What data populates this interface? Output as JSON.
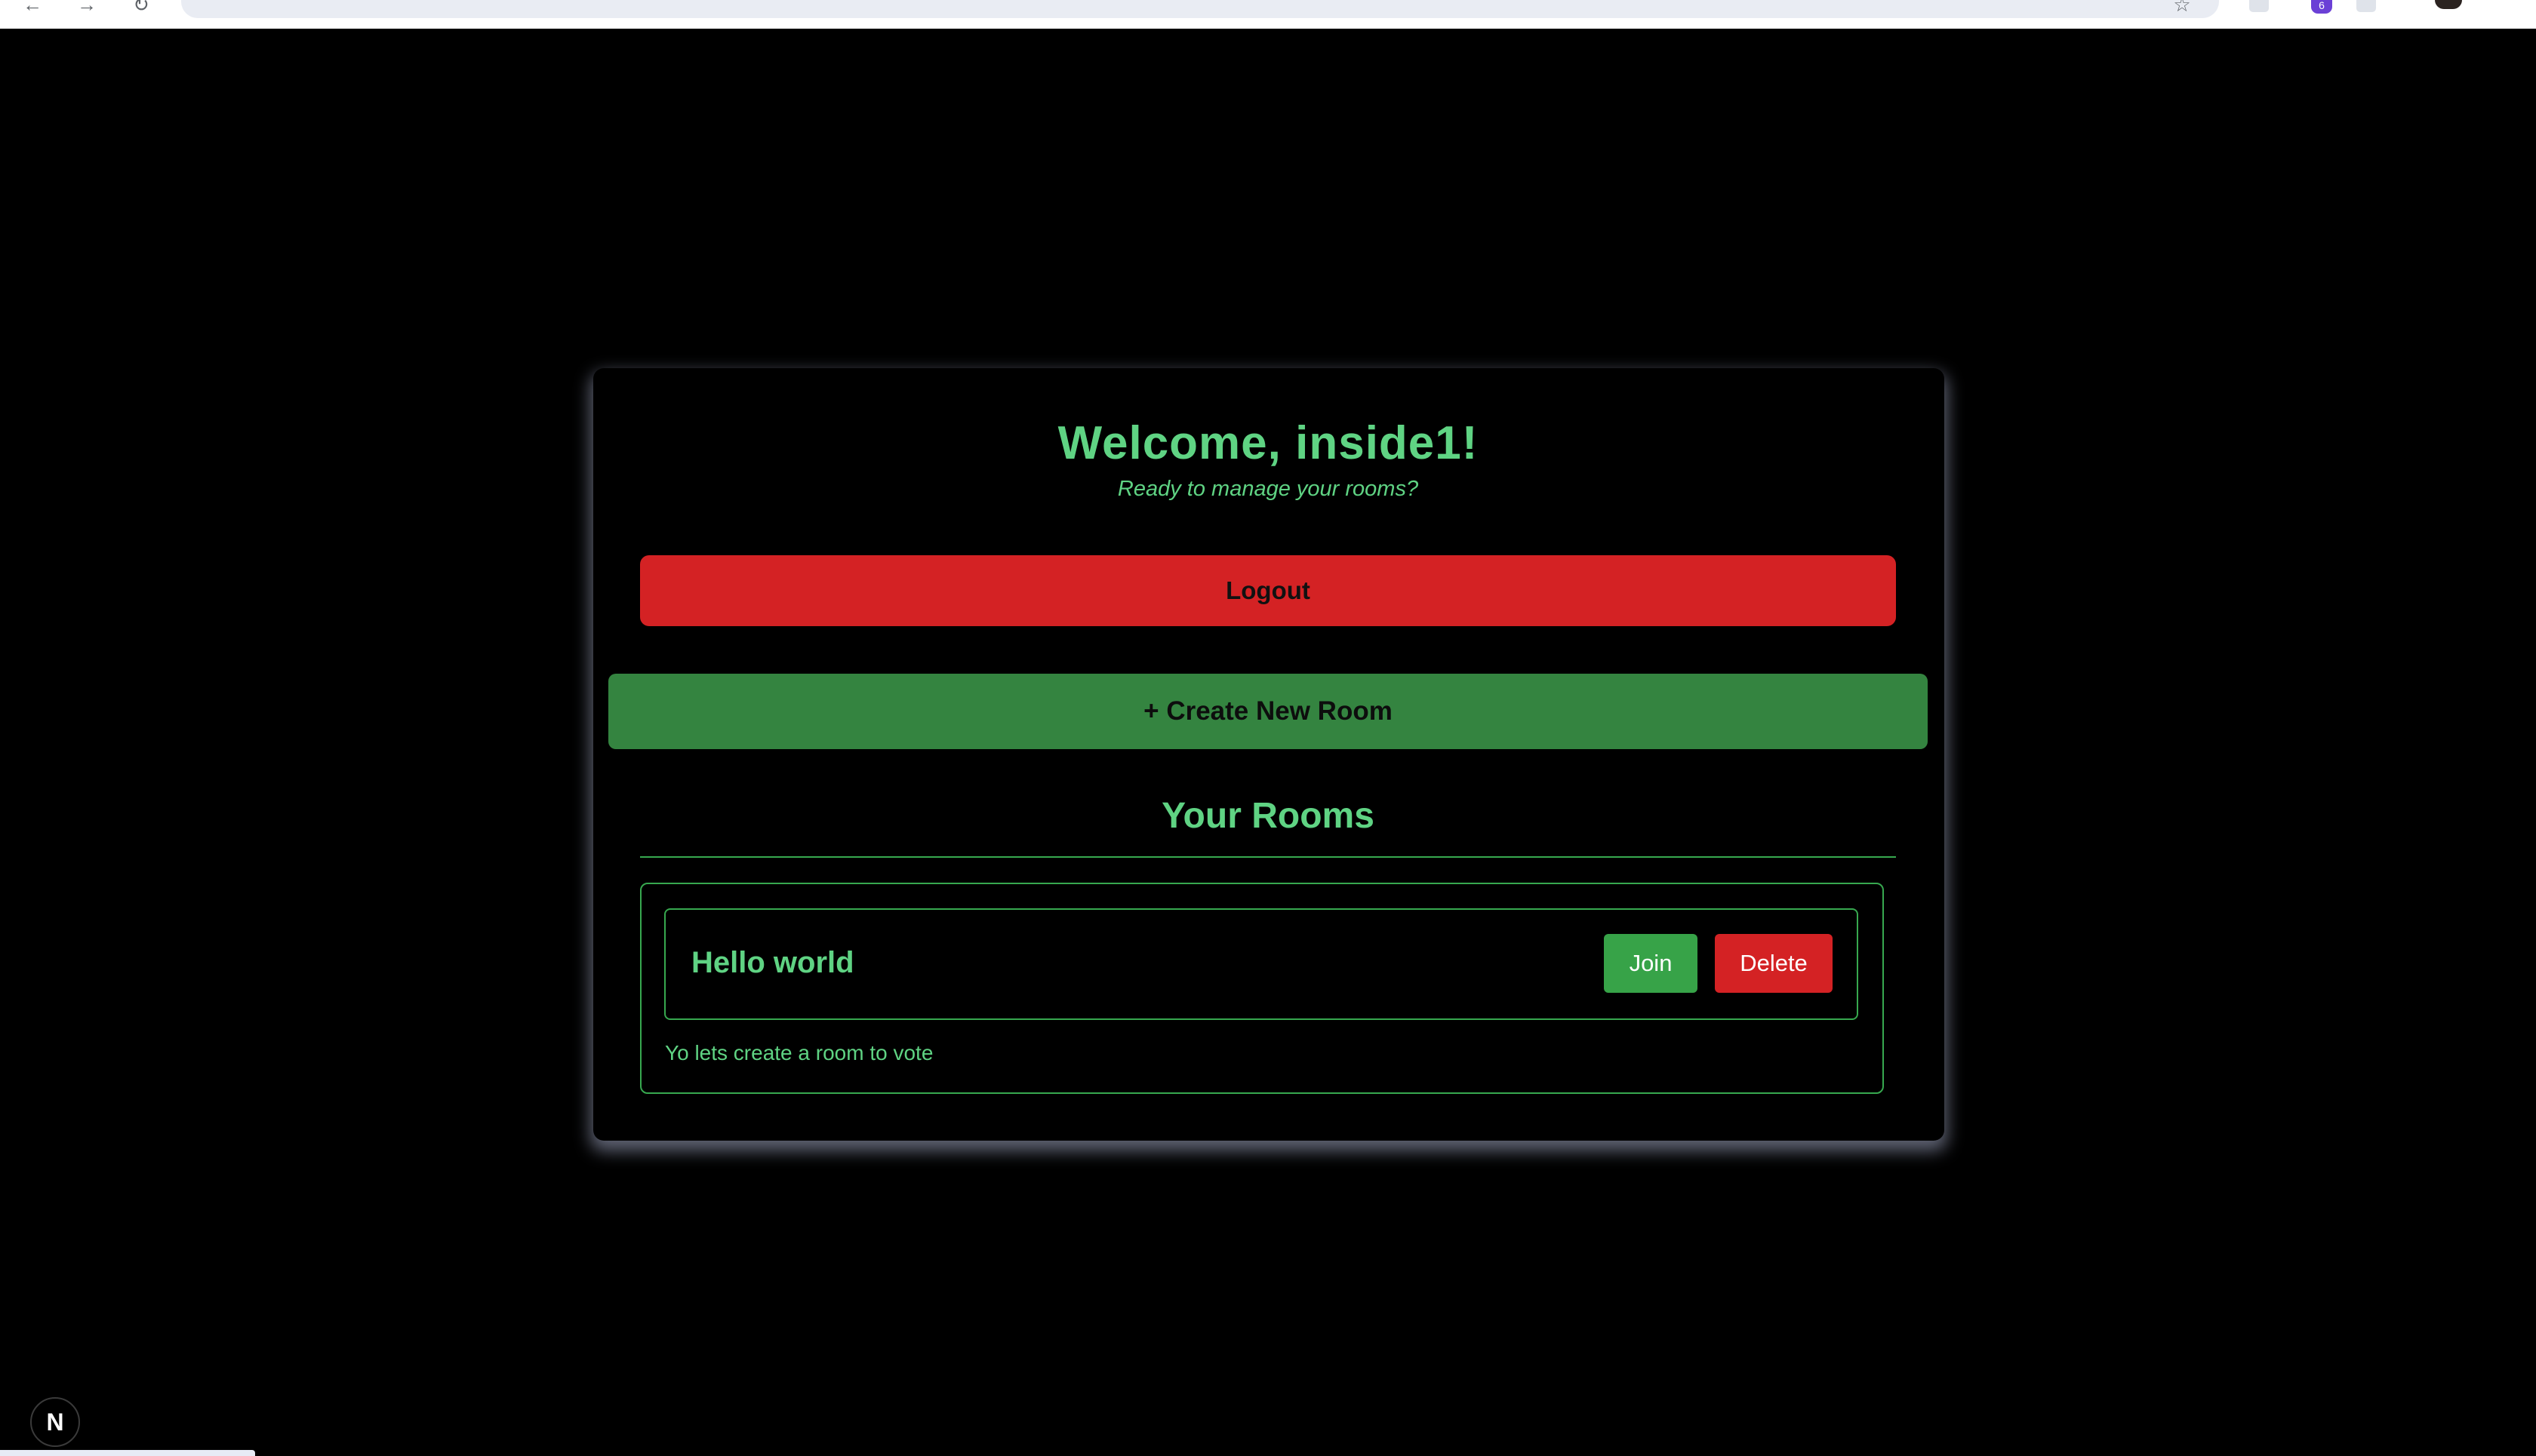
{
  "browser": {
    "nav_back_glyph": "←",
    "nav_forward_glyph": "→",
    "reload_glyph": "↻",
    "bookmark_glyph": "☆",
    "extension_badge_count": "6"
  },
  "header": {
    "welcome_text": "Welcome, inside1!",
    "subtitle": "Ready to manage your rooms?"
  },
  "actions": {
    "logout_label": "Logout",
    "create_room_label": "+ Create New Room"
  },
  "rooms_section": {
    "heading": "Your Rooms",
    "rooms": [
      {
        "name": "Hello world",
        "description": "Yo lets create a room to vote",
        "join_label": "Join",
        "delete_label": "Delete"
      }
    ]
  },
  "dev_indicator": {
    "label": "N"
  },
  "colors": {
    "background": "#000000",
    "accent_green_text": "#5fd383",
    "border_green": "#37a84f",
    "danger_red": "#d42224",
    "create_green": "#348440",
    "join_green": "#37a348"
  }
}
